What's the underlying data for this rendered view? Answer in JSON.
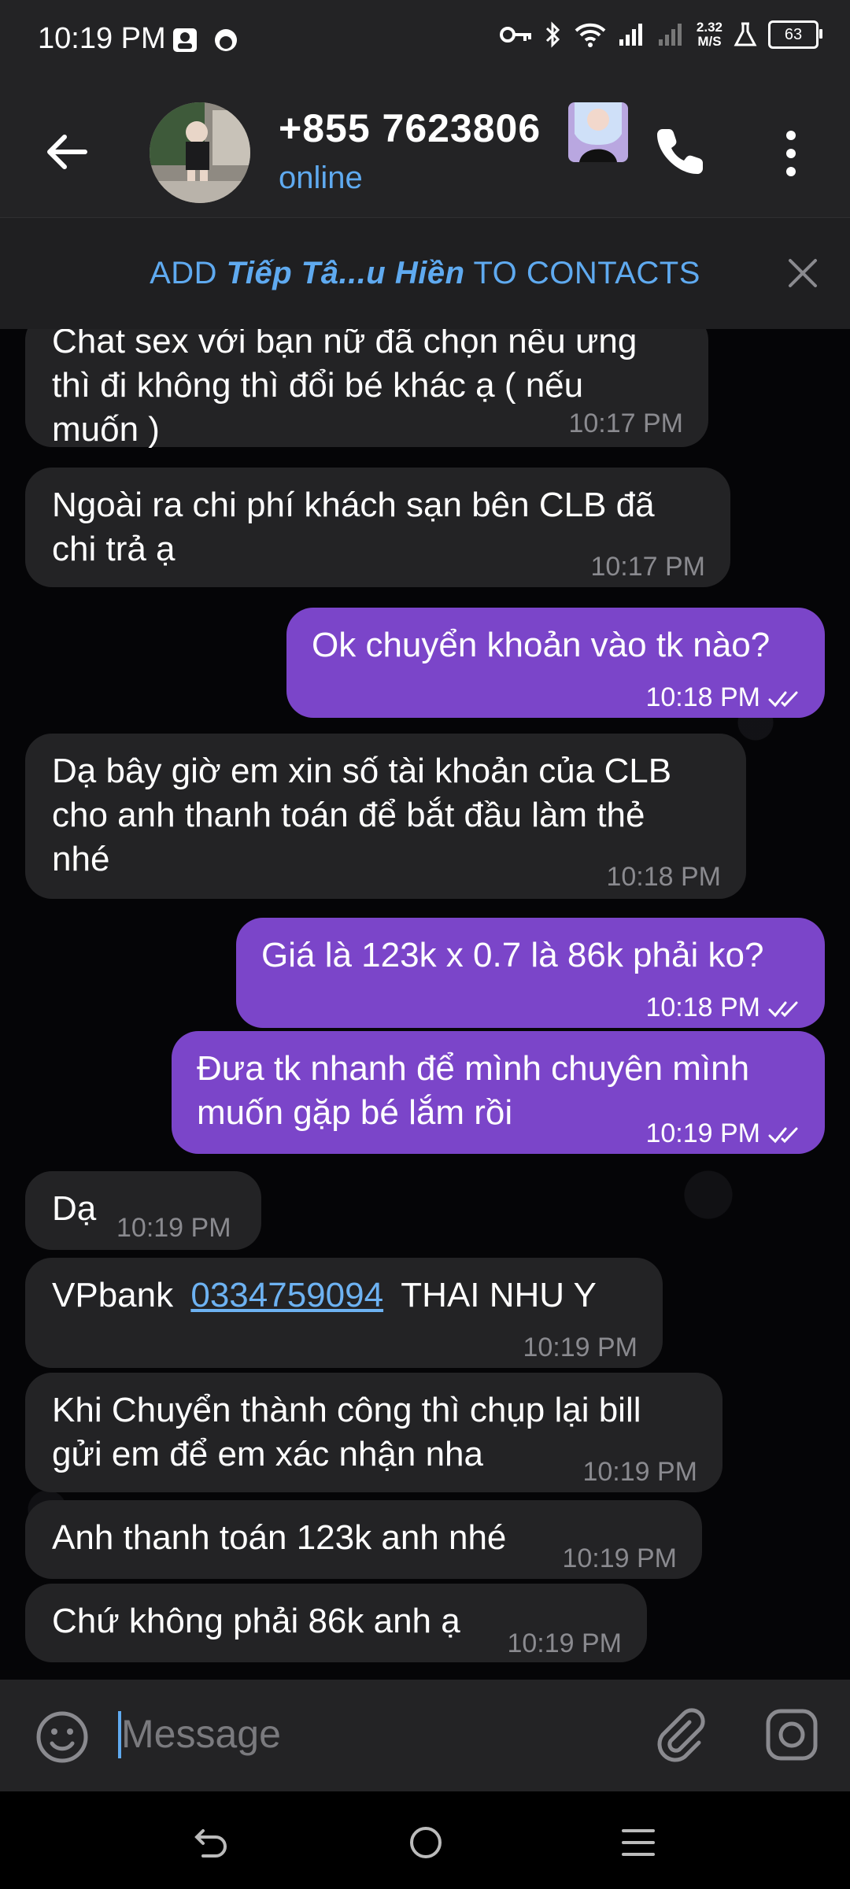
{
  "status_bar": {
    "time": "10:19 PM",
    "network_speed_value": "2.32",
    "network_speed_unit": "M/S",
    "battery": "63"
  },
  "header": {
    "title": "+855 7623806",
    "status": "online"
  },
  "add_contact": {
    "prefix": "ADD ",
    "name": "Tiếp Tâ...u Hiền",
    "suffix": " TO CONTACTS"
  },
  "messages": [
    {
      "dir": "in",
      "text": "Chat sex với bạn nữ đã chọn nếu ưng\nthì đi không thì đổi bé khác ạ ( nếu\nmuốn )",
      "time": "10:17 PM"
    },
    {
      "dir": "in",
      "text": "Ngoài ra chi phí khách sạn bên CLB đã\nchi trả ạ",
      "time": "10:17 PM"
    },
    {
      "dir": "out",
      "text": "Ok chuyển khoản vào tk nào?",
      "time": "10:18 PM"
    },
    {
      "dir": "in",
      "text": "Dạ bây giờ em xin số tài khoản của CLB\ncho anh thanh toán để bắt đầu làm thẻ\nnhé",
      "time": "10:18 PM"
    },
    {
      "dir": "out",
      "text": "Giá là 123k x 0.7 là 86k phải ko?",
      "time": "10:18 PM"
    },
    {
      "dir": "out",
      "text": "Đưa tk nhanh để mình chuyên mình\nmuốn gặp bé lắm rồi",
      "time": "10:19 PM"
    },
    {
      "dir": "in",
      "text": "Dạ",
      "time": "10:19 PM"
    },
    {
      "dir": "in",
      "bank": "VPbank",
      "account": "0334759094",
      "holder": "THAI NHU Y",
      "time": "10:19 PM"
    },
    {
      "dir": "in",
      "text": "Khi Chuyển thành công thì chụp lại bill\ngửi em để em xác nhận nha",
      "time": "10:19 PM"
    },
    {
      "dir": "in",
      "text": "Anh thanh toán 123k anh nhé",
      "time": "10:19 PM"
    },
    {
      "dir": "in",
      "text": "Chứ không phải 86k anh ạ",
      "time": "10:19 PM"
    }
  ],
  "input": {
    "placeholder": "Message"
  },
  "colors": {
    "accent": "#5faaf0",
    "outgoing_bubble": "#7b45c9",
    "incoming_bubble": "#232325",
    "bars": "#232325"
  }
}
